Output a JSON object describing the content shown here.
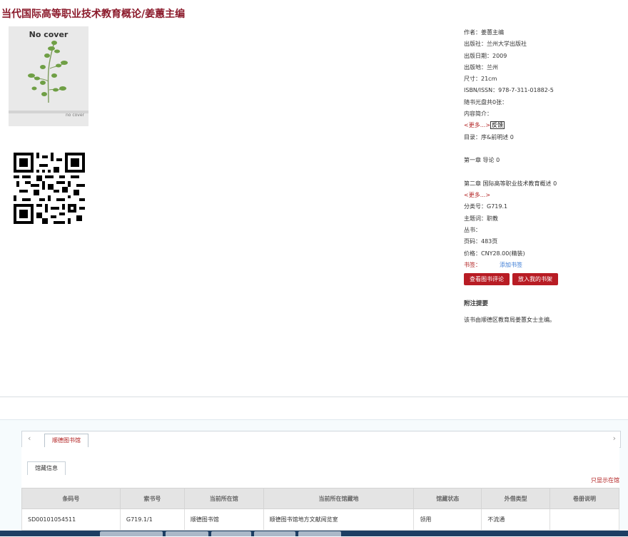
{
  "title": "当代国际高等职业技术教育概论/姜蕙主编",
  "cover": {
    "top_text": "No cover",
    "bottom_text": "no cover"
  },
  "meta": {
    "author": "作者：姜蕙主编",
    "publisher": "出版社：兰州大学出版社",
    "date": "出版日期：2009",
    "place": "出版地：兰州",
    "size": "尺寸：21cm",
    "isbn": "ISBN/ISSN：978-7-311-01882-5",
    "disc": "随书光盘共0张：",
    "intro_label": "内容简介：",
    "more1": "<更多...>",
    "feedback": "反馈",
    "toc": "目录：序&前明述 0",
    "ch1": "第一章 导论 0",
    "ch2": "第二章 国际高等职业技术教育概述 0",
    "more2": "<更多...>",
    "classno": "分类号：G719.1",
    "subject": "主题词：职教",
    "series": "丛书：",
    "pages": "页码：483页",
    "price": "价格：CNY28.00(精装)",
    "bookmark_label": "书签：",
    "add_bookmark": "添加书签",
    "btn_review": "查看图书评论",
    "btn_shelf": "放入我的书架",
    "note_title": "附注提要",
    "note_text": "该书由顺德区教育局姜蕙女士主编。"
  },
  "library": {
    "tab": "顺德图书馆",
    "arrow_left": "‹",
    "arrow_right": "›",
    "subtab": "馆藏信息",
    "show_only": "只显示在馆",
    "columns": [
      "条码号",
      "索书号",
      "当前所在馆",
      "当前所在馆藏地",
      "馆藏状态",
      "外借类型",
      "卷册说明"
    ],
    "rows": [
      [
        "SD00101054511",
        "G719.1/1",
        "顺德图书馆",
        "顺德图书馆地方文献阅览室",
        "领用",
        "不流通",
        ""
      ]
    ]
  }
}
